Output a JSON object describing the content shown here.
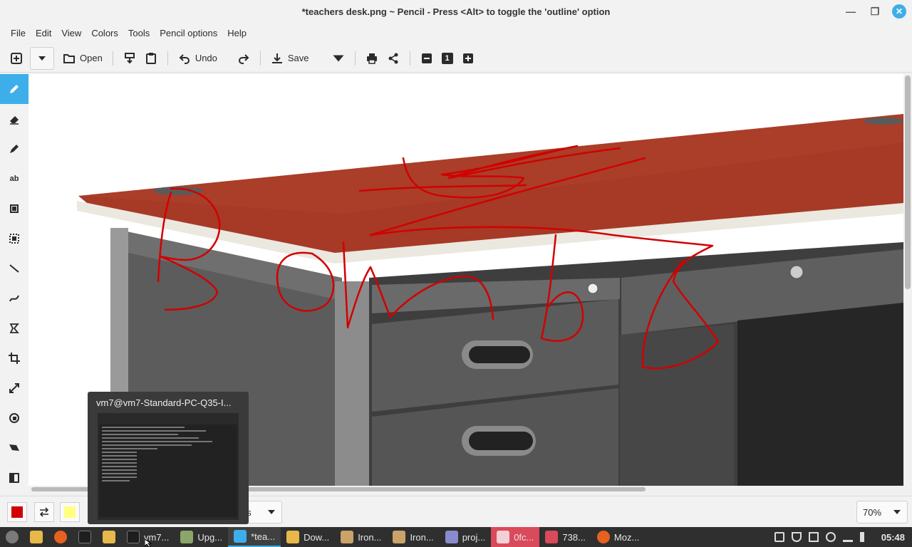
{
  "window": {
    "title": "*teachers desk.png ~ Pencil - Press <Alt> to toggle the 'outline' option",
    "controls": [
      "minimize-icon",
      "maximize-icon",
      "close-icon"
    ]
  },
  "menu": {
    "items": [
      "File",
      "Edit",
      "View",
      "Colors",
      "Tools",
      "Pencil options",
      "Help"
    ]
  },
  "toolbar": {
    "open_label": "Open",
    "undo_label": "Undo",
    "save_label": "Save",
    "zoom_reset_label": "1"
  },
  "tools": [
    {
      "name": "pencil",
      "icon": "pencil-icon",
      "active": true
    },
    {
      "name": "eraser",
      "icon": "eraser-icon"
    },
    {
      "name": "highlighter",
      "icon": "highlighter-icon"
    },
    {
      "name": "text",
      "icon": "text-icon",
      "label": "ab"
    },
    {
      "name": "rectangle",
      "icon": "rectangle-icon"
    },
    {
      "name": "rectangle-selection",
      "icon": "selection-icon"
    },
    {
      "name": "line",
      "icon": "line-icon"
    },
    {
      "name": "curve",
      "icon": "curve-icon"
    },
    {
      "name": "freeshape",
      "icon": "freeshape-icon"
    },
    {
      "name": "crop",
      "icon": "crop-icon"
    },
    {
      "name": "scale",
      "icon": "scale-icon"
    },
    {
      "name": "rotate",
      "icon": "rotate-icon"
    },
    {
      "name": "skew",
      "icon": "skew-icon"
    },
    {
      "name": "filters",
      "icon": "filters-icon"
    }
  ],
  "colors": {
    "primary": "#d10000",
    "secondary": "#ffff80",
    "accent": "#3daee9"
  },
  "options": {
    "partial_label": "ns"
  },
  "zoom": {
    "value": "70%"
  },
  "preview": {
    "title": "vm7@vm7-Standard-PC-Q35-I..."
  },
  "taskbar": {
    "apps": [
      {
        "label": "vm7...",
        "icon": "terminal-icon"
      },
      {
        "label": "Upg...",
        "icon": "shield-icon"
      },
      {
        "label": "*tea...",
        "icon": "pencil-app-icon",
        "active": true
      },
      {
        "label": "Dow...",
        "icon": "folder-icon"
      },
      {
        "label": "Iron...",
        "icon": "archive-icon"
      },
      {
        "label": "Iron...",
        "icon": "archive-icon"
      },
      {
        "label": "proj...",
        "icon": "document-icon"
      },
      {
        "label": "0fc...",
        "icon": "image-viewer-icon"
      },
      {
        "label": "738...",
        "icon": "image-viewer-icon"
      },
      {
        "label": "Moz...",
        "icon": "firefox-icon"
      }
    ],
    "clock": "05:48"
  }
}
